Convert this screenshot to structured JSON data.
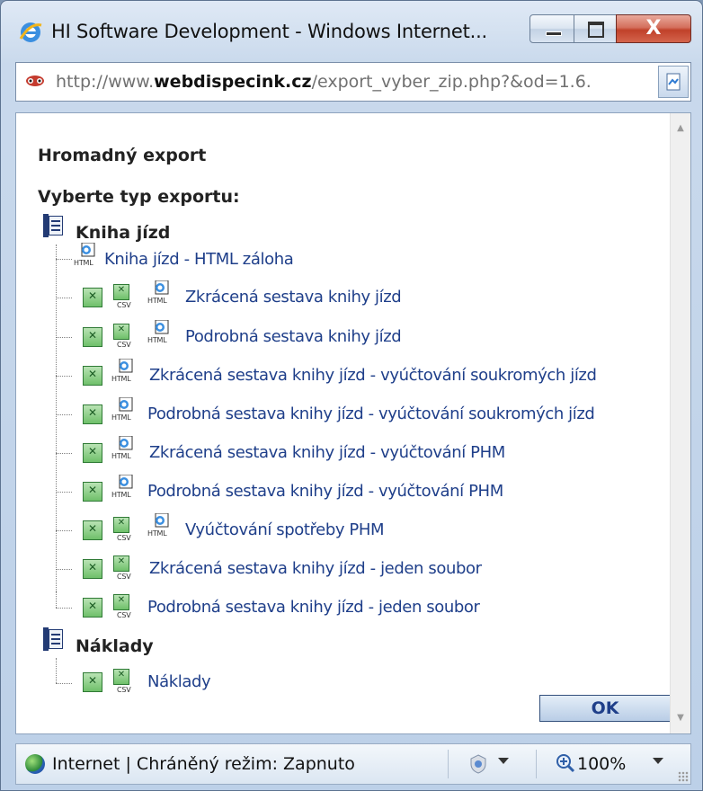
{
  "window": {
    "title": "HI Software Development - Windows Internet...",
    "close_label": "X"
  },
  "address": {
    "url_prefix": "http://www.",
    "url_domain": "webdispecink.cz",
    "url_path": "/export_vyber_zip.php?&od=1.6."
  },
  "page": {
    "heading": "Hromadný export",
    "subheading": "Vyberte typ exportu:",
    "categories": [
      {
        "label": "Kniha jízd",
        "items": [
          {
            "label": "Kniha jízd - HTML záloha",
            "icons": [
              "html"
            ]
          },
          {
            "label": "Zkrácená sestava knihy jízd",
            "icons": [
              "xls",
              "csv",
              "html"
            ]
          },
          {
            "label": "Podrobná sestava knihy jízd",
            "icons": [
              "xls",
              "csv",
              "html"
            ]
          },
          {
            "label": "Zkrácená sestava knihy jízd - vyúčtování soukromých jízd",
            "icons": [
              "xls",
              "html"
            ]
          },
          {
            "label": "Podrobná sestava knihy jízd - vyúčtování soukromých jízd",
            "icons": [
              "xls",
              "html"
            ]
          },
          {
            "label": "Zkrácená sestava knihy jízd - vyúčtování PHM",
            "icons": [
              "xls",
              "html"
            ]
          },
          {
            "label": "Podrobná sestava knihy jízd - vyúčtování PHM",
            "icons": [
              "xls",
              "html"
            ]
          },
          {
            "label": "Vyúčtování spotřeby PHM",
            "icons": [
              "xls",
              "csv",
              "html"
            ]
          },
          {
            "label": "Zkrácená sestava knihy jízd - jeden soubor",
            "icons": [
              "xls",
              "csv"
            ]
          },
          {
            "label": "Podrobná sestava knihy jízd - jeden soubor",
            "icons": [
              "xls",
              "csv"
            ]
          }
        ]
      },
      {
        "label": "Náklady",
        "items": [
          {
            "label": "Náklady",
            "icons": [
              "xls",
              "csv"
            ]
          }
        ]
      }
    ],
    "icon_tags": {
      "csv": "CSV",
      "html": "HTML"
    },
    "ok_label": "OK"
  },
  "status": {
    "zone_text": "Internet | Chráněný režim: Zapnuto",
    "zoom": "100%"
  },
  "colors": {
    "link": "#1f3f8a",
    "close_button": "#c0412a",
    "chrome": "#c9d9ec"
  }
}
